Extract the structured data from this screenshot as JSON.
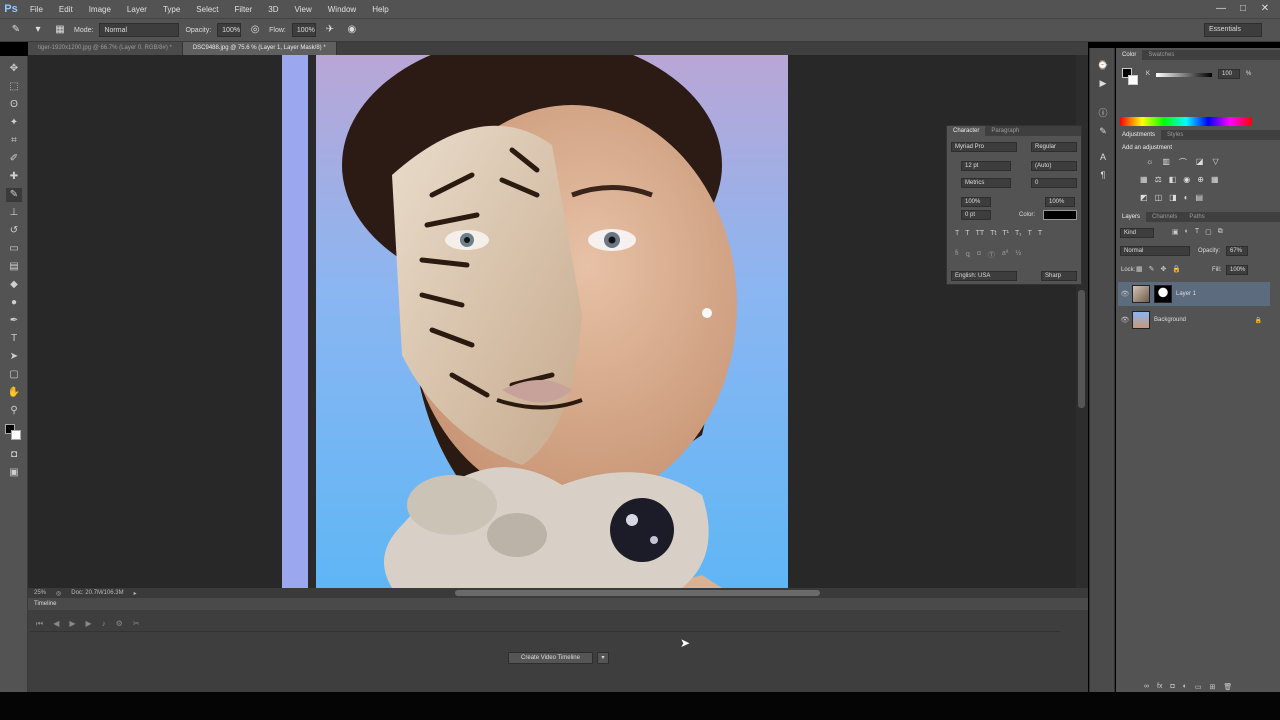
{
  "app": {
    "logo": "Ps"
  },
  "menu": [
    "File",
    "Edit",
    "Image",
    "Layer",
    "Type",
    "Select",
    "Filter",
    "3D",
    "View",
    "Window",
    "Help"
  ],
  "window_controls": [
    "—",
    "□",
    "✕"
  ],
  "options_bar": {
    "mode_label": "Mode:",
    "mode_value": "Normal",
    "opacity_label": "Opacity:",
    "opacity_value": "100%",
    "flow_label": "Flow:",
    "flow_value": "100%",
    "workspace": "Essentials"
  },
  "tabs": [
    {
      "label": "tiger-1920x1200.jpg @ 66.7% (Layer 0, RGB/8#) *",
      "active": false
    },
    {
      "label": "DSC9488.jpg @ 75.6 % (Layer 1, Layer Mask/8) *",
      "active": true
    }
  ],
  "status": {
    "zoom": "25%",
    "doc": "Doc: 20.7M/106.3M"
  },
  "timeline": {
    "title": "Timeline",
    "create_button": "Create Video Timeline"
  },
  "color_panel": {
    "tabs": [
      "Color",
      "Swatches"
    ],
    "k_label": "K",
    "k_value": "100",
    "k_unit": "%"
  },
  "adjustments_panel": {
    "tabs": [
      "Adjustments",
      "Styles"
    ],
    "title": "Add an adjustment"
  },
  "character_panel": {
    "tabs": [
      "Character",
      "Paragraph"
    ],
    "font_family": "Myriad Pro",
    "font_style": "Regular",
    "size": "12 pt",
    "leading": "(Auto)",
    "kerning": "Metrics",
    "tracking": "0",
    "vscale": "100%",
    "hscale": "100%",
    "baseline": "0 pt",
    "color_label": "Color:",
    "language": "English: USA",
    "antialias": "Sharp"
  },
  "layers_panel": {
    "tabs": [
      "Layers",
      "Channels",
      "Paths"
    ],
    "kind": "Kind",
    "blend_mode": "Normal",
    "opacity_label": "Opacity:",
    "opacity_value": "67%",
    "lock_label": "Lock:",
    "fill_label": "Fill:",
    "fill_value": "100%",
    "layers": [
      {
        "name": "Layer 1",
        "selected": true
      },
      {
        "name": "Background",
        "selected": false
      }
    ]
  }
}
